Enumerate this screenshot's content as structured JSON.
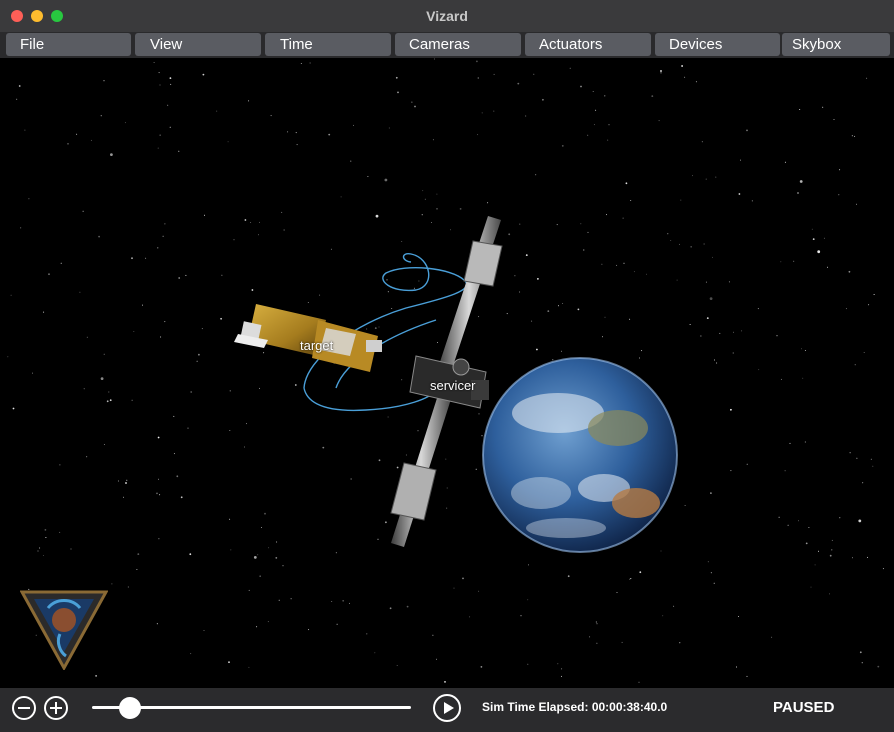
{
  "window": {
    "title": "Vizard"
  },
  "menu": {
    "items": [
      {
        "label": "File"
      },
      {
        "label": "View"
      },
      {
        "label": "Time"
      },
      {
        "label": "Cameras"
      },
      {
        "label": "Actuators"
      },
      {
        "label": "Devices"
      },
      {
        "label": "Skybox"
      }
    ]
  },
  "scene": {
    "objects": [
      {
        "label": "target"
      },
      {
        "label": "servicer"
      }
    ],
    "trajectory_color": "#4a9fd8",
    "logo": "mission-patch-icon"
  },
  "controls": {
    "zoom_out_icon": "minus-circle-icon",
    "zoom_in_icon": "plus-circle-icon",
    "time_slider_position": 0.12,
    "play_icon": "play-icon",
    "sim_time": "Sim Time Elapsed: 00:00:38:40.0",
    "status": "PAUSED"
  }
}
